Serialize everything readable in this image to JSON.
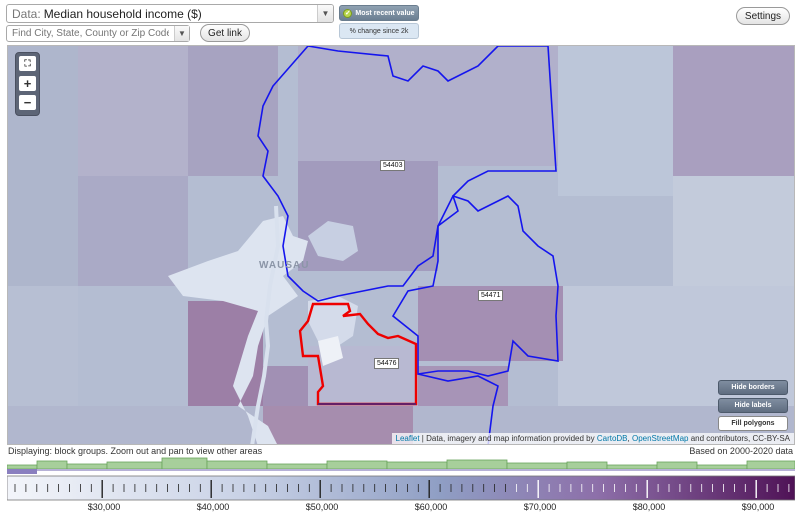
{
  "toolbar": {
    "data_prefix": "Data:",
    "data_value": "Median household income ($)",
    "find_placeholder": "Find City, State, County or Zip Code",
    "get_link_label": "Get link",
    "most_recent_label": "Most recent value",
    "pct_change_label": "% change since 2k",
    "settings_label": "Settings"
  },
  "map": {
    "zoom_fit_icon": "fullscreen-icon",
    "zoom_in_label": "+",
    "zoom_out_label": "−",
    "town_label": "WAUSAU",
    "zip_labels": [
      "54403",
      "54471",
      "54476"
    ],
    "hide_borders_label": "Hide borders",
    "hide_labels_label": "Hide labels",
    "fill_polygons_label": "Fill polygons",
    "attribution": {
      "leaflet": "Leaflet",
      "prefix": " | Data, imagery and map information provided by ",
      "carto": "CartoDB",
      "sep": ", ",
      "osm": "OpenStreetMap",
      "suffix": " and contributors, CC-BY-SA"
    },
    "colors": {
      "selected_border": "#ff0000",
      "zip_border": "#1a1aff",
      "fill_low": "#dfe6f2",
      "fill_high": "#6b2468"
    }
  },
  "footer": {
    "displaying": "Displaying: block groups. Zoom out and pan to view other areas",
    "based_on": "Based on 2000-2020 data"
  },
  "legend": {
    "tick_labels": [
      "$30,000",
      "$40,000",
      "$50,000",
      "$60,000",
      "$70,000",
      "$80,000",
      "$90,000"
    ]
  }
}
